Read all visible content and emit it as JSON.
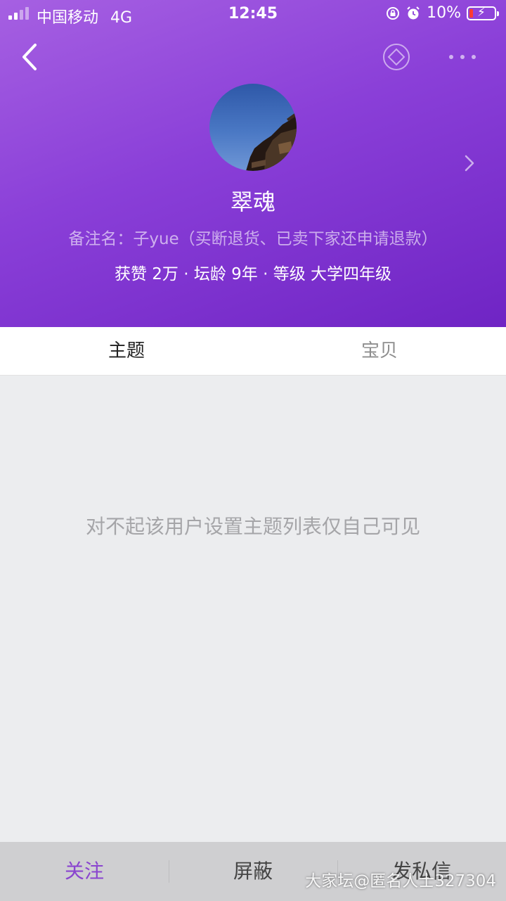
{
  "status_bar": {
    "carrier": "中国移动",
    "network": "4G",
    "time": "12:45",
    "battery": "10%"
  },
  "icons": {
    "back": "chevron-left-icon",
    "diamond": "diamond-icon",
    "more": "more-dots-icon",
    "profile_chevron": "chevron-right-icon",
    "rotation_lock": "rotation-lock-icon",
    "alarm": "alarm-icon"
  },
  "profile": {
    "username": "翠魂",
    "remark": "备注名：子yue（买断退货、已卖下家还申请退款）",
    "stats": "获赞 2万 · 坛龄 9年 · 等级 大学四年级"
  },
  "tabs": [
    {
      "label": "主题",
      "active": true
    },
    {
      "label": "宝贝",
      "active": false
    }
  ],
  "content": {
    "empty_message": "对不起该用户设置主题列表仅自己可见"
  },
  "bottom_bar": {
    "follow": "关注",
    "block": "屏蔽",
    "message": "发私信"
  },
  "watermark": "大家坛@匿名人士327304",
  "colors": {
    "header_gradient_start": "#a660e2",
    "header_gradient_end": "#6f24c4",
    "follow_accent": "#8a45cf",
    "battery_low": "#ff3b30"
  }
}
